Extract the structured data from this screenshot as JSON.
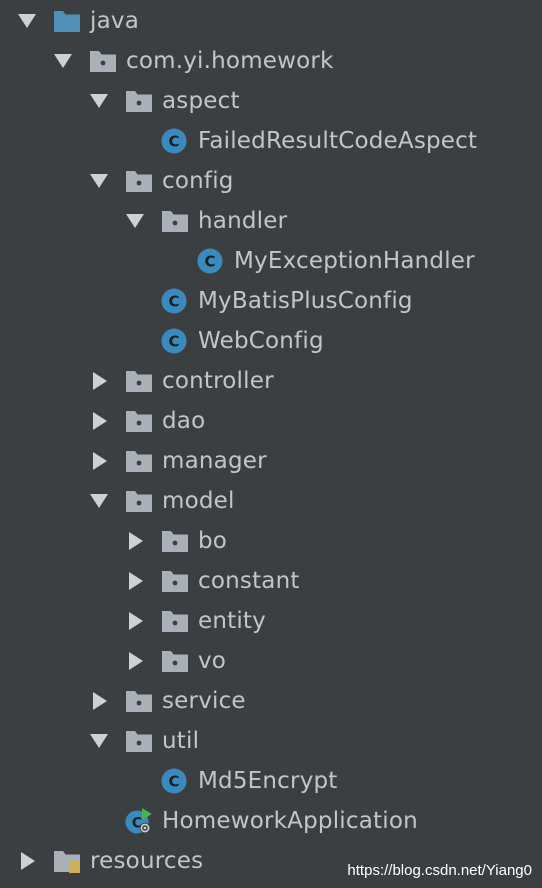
{
  "colors": {
    "background": "#3c3f41",
    "text": "#c5c5c5",
    "arrow": "#d0d0d0",
    "folder": "#a9b0b7",
    "source_folder": "#4f8fb8",
    "class_badge": "#3a8bbd",
    "run_marker": "#4caf50",
    "resources_marker": "#d9b232"
  },
  "project_tree": {
    "items": [
      {
        "label": "java",
        "depth": 0,
        "expander": "expanded",
        "icon": "source-root-folder-icon"
      },
      {
        "label": "com.yi.homework",
        "depth": 1,
        "expander": "expanded",
        "icon": "package-icon"
      },
      {
        "label": "aspect",
        "depth": 2,
        "expander": "expanded",
        "icon": "package-icon"
      },
      {
        "label": "FailedResultCodeAspect",
        "depth": 3,
        "expander": "none",
        "icon": "class-icon"
      },
      {
        "label": "config",
        "depth": 2,
        "expander": "expanded",
        "icon": "package-icon"
      },
      {
        "label": "handler",
        "depth": 3,
        "expander": "expanded",
        "icon": "package-icon"
      },
      {
        "label": "MyExceptionHandler",
        "depth": 4,
        "expander": "none",
        "icon": "class-icon"
      },
      {
        "label": "MyBatisPlusConfig",
        "depth": 3,
        "expander": "none",
        "icon": "class-icon"
      },
      {
        "label": "WebConfig",
        "depth": 3,
        "expander": "none",
        "icon": "class-icon"
      },
      {
        "label": "controller",
        "depth": 2,
        "expander": "collapsed",
        "icon": "package-icon"
      },
      {
        "label": "dao",
        "depth": 2,
        "expander": "collapsed",
        "icon": "package-icon"
      },
      {
        "label": "manager",
        "depth": 2,
        "expander": "collapsed",
        "icon": "package-icon"
      },
      {
        "label": "model",
        "depth": 2,
        "expander": "expanded",
        "icon": "package-icon"
      },
      {
        "label": "bo",
        "depth": 3,
        "expander": "collapsed",
        "icon": "package-icon"
      },
      {
        "label": "constant",
        "depth": 3,
        "expander": "collapsed",
        "icon": "package-icon"
      },
      {
        "label": "entity",
        "depth": 3,
        "expander": "collapsed",
        "icon": "package-icon"
      },
      {
        "label": "vo",
        "depth": 3,
        "expander": "collapsed",
        "icon": "package-icon"
      },
      {
        "label": "service",
        "depth": 2,
        "expander": "collapsed",
        "icon": "package-icon"
      },
      {
        "label": "util",
        "depth": 2,
        "expander": "expanded",
        "icon": "package-icon"
      },
      {
        "label": "Md5Encrypt",
        "depth": 3,
        "expander": "none",
        "icon": "class-icon"
      },
      {
        "label": "HomeworkApplication",
        "depth": 2,
        "expander": "none",
        "icon": "spring-boot-application-icon"
      },
      {
        "label": "resources",
        "depth": 0,
        "expander": "collapsed",
        "icon": "resources-root-folder-icon"
      }
    ]
  },
  "watermark": "https://blog.csdn.net/Yiang0"
}
